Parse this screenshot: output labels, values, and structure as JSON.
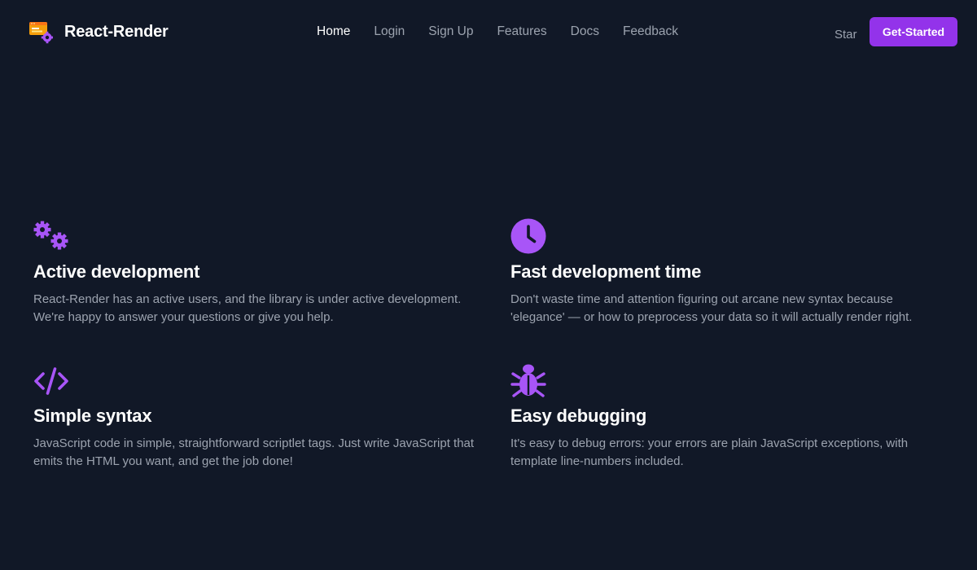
{
  "brand": {
    "name": "React-Render",
    "logo_icon": "browser-gear-logo-icon",
    "colors": {
      "accent": "#9333ea",
      "icon": "#a855f7",
      "background": "#111827"
    }
  },
  "nav": {
    "items": [
      {
        "label": "Home",
        "active": true
      },
      {
        "label": "Login",
        "active": false
      },
      {
        "label": "Sign Up",
        "active": false
      },
      {
        "label": "Features",
        "active": false
      },
      {
        "label": "Docs",
        "active": false
      },
      {
        "label": "Feedback",
        "active": false
      }
    ],
    "star_label": "Star",
    "cta_label": "Get-Started"
  },
  "features": [
    {
      "icon": "gears-icon",
      "title": "Active development",
      "description": "React-Render has an active users, and the library is under active development. We're happy to answer your questions or give you help."
    },
    {
      "icon": "clock-icon",
      "title": "Fast development time",
      "description": "Don't waste time and attention figuring out arcane new syntax because 'elegance' — or how to preprocess your data so it will actually render right."
    },
    {
      "icon": "code-icon",
      "title": "Simple syntax",
      "description": "JavaScript code in simple, straightforward scriptlet tags. Just write JavaScript that emits the HTML you want, and get the job done!"
    },
    {
      "icon": "bug-icon",
      "title": "Easy debugging",
      "description": "It's easy to debug errors: your errors are plain JavaScript exceptions, with template line-numbers included."
    }
  ]
}
